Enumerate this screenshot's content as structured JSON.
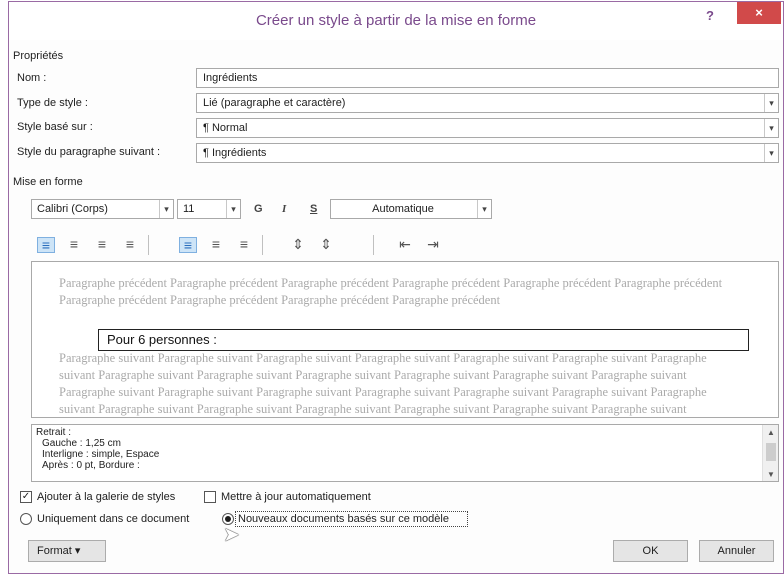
{
  "dialog": {
    "title": "Créer un style à partir de la mise en forme",
    "help": "?",
    "close": "×"
  },
  "properties": {
    "section": "Propriétés",
    "name_label": "Nom :",
    "name_value": "Ingrédients",
    "type_label": "Type de style :",
    "type_value": "Lié (paragraphe et caractère)",
    "based_label": "Style basé sur :",
    "based_value": "¶  Normal",
    "next_label": "Style du paragraphe suivant :",
    "next_value": "¶  Ingrédients"
  },
  "formatting": {
    "section": "Mise en forme",
    "font": "Calibri (Corps)",
    "size": "11",
    "bold": "G",
    "italic": "I",
    "underline": "S",
    "color": "Automatique"
  },
  "alignment_icons": [
    "align-left-icon",
    "align-center-icon",
    "align-right-icon",
    "justify-icon",
    "single-spacing-icon",
    "one-half-spacing-icon",
    "double-spacing-icon",
    "increase-paragraph-spacing-icon",
    "decrease-paragraph-spacing-icon",
    "decrease-indent-icon",
    "increase-indent-icon"
  ],
  "preview": {
    "previous": "Paragraphe précédent Paragraphe précédent Paragraphe précédent Paragraphe précédent Paragraphe précédent Paragraphe précédent Paragraphe précédent Paragraphe précédent Paragraphe précédent Paragraphe précédent",
    "sample": "Pour 6 personnes :",
    "following": "Paragraphe suivant Paragraphe suivant Paragraphe suivant Paragraphe suivant Paragraphe suivant Paragraphe suivant Paragraphe suivant Paragraphe suivant Paragraphe suivant Paragraphe suivant Paragraphe suivant Paragraphe suivant Paragraphe suivant Paragraphe suivant Paragraphe suivant Paragraphe suivant Paragraphe suivant Paragraphe suivant Paragraphe suivant Paragraphe suivant Paragraphe suivant Paragraphe suivant Paragraphe suivant Paragraphe suivant Paragraphe suivant Paragraphe suivant"
  },
  "description": {
    "line1": "Retrait :",
    "line2": "Gauche :  1,25 cm",
    "line3": "Interligne : simple, Espace",
    "line4": "Après : 0 pt, Bordure :"
  },
  "options": {
    "add_gallery": "Ajouter à la galerie de styles",
    "auto_update": "Mettre à jour automatiquement",
    "only_doc": "Uniquement dans ce document",
    "new_docs": "Nouveaux documents basés sur ce modèle"
  },
  "buttons": {
    "format": "Format ▾",
    "ok": "OK",
    "cancel": "Annuler"
  },
  "colors": {
    "accent": "#7a4a8c",
    "close": "#d14a4a",
    "selected_icon": "#cde4f7"
  }
}
